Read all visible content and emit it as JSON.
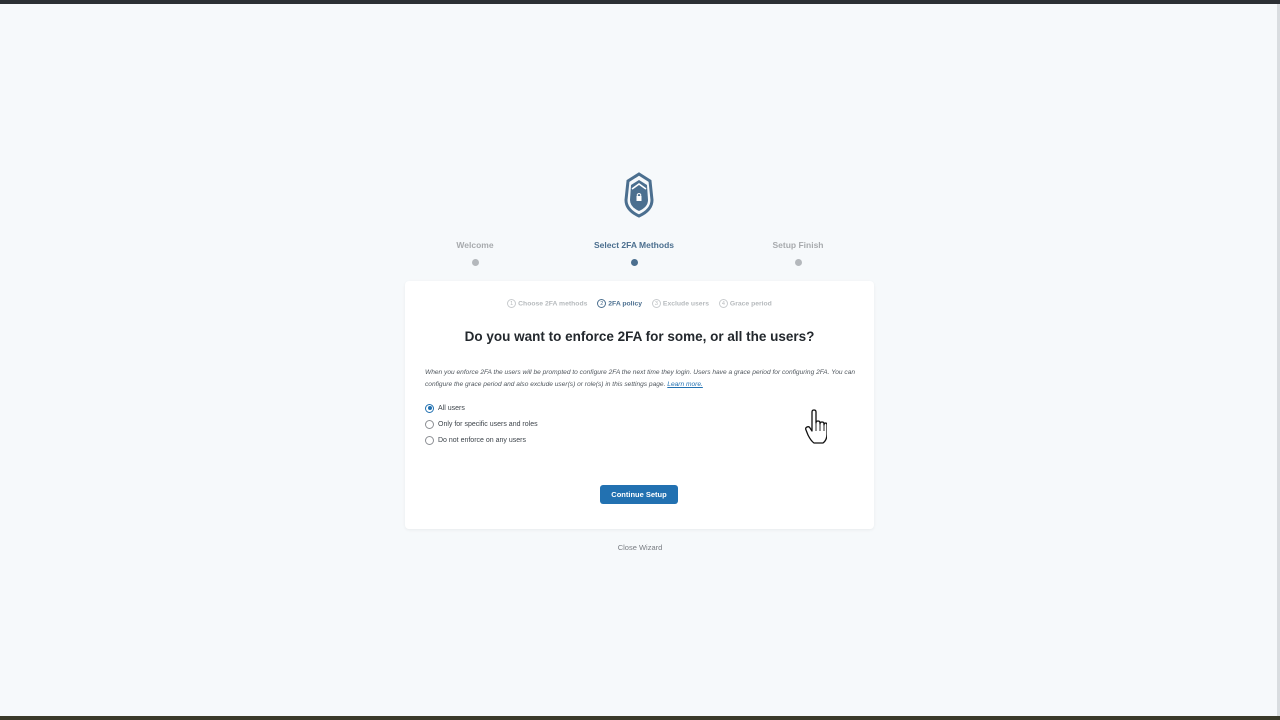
{
  "wizard": {
    "steps": [
      {
        "label": "Welcome",
        "active": false
      },
      {
        "label": "Select 2FA Methods",
        "active": true
      },
      {
        "label": "Setup Finish",
        "active": false
      }
    ],
    "substeps": [
      {
        "num": "1",
        "label": "Choose 2FA methods",
        "active": false
      },
      {
        "num": "2",
        "label": "2FA policy",
        "active": true
      },
      {
        "num": "3",
        "label": "Exclude users",
        "active": false
      },
      {
        "num": "4",
        "label": "Grace period",
        "active": false
      }
    ],
    "title": "Do you want to enforce 2FA for some, or all the users?",
    "description": "When you enforce 2FA the users will be prompted to configure 2FA the next time they login. Users have a grace period for configuring 2FA. You can configure the grace period and also exclude user(s) or role(s) in this settings page.",
    "learn_more": "Learn more.",
    "options": [
      {
        "label": "All users",
        "checked": true
      },
      {
        "label": "Only for specific users and roles",
        "checked": false
      },
      {
        "label": "Do not enforce on any users",
        "checked": false
      }
    ],
    "continue_label": "Continue Setup",
    "close_label": "Close Wizard"
  },
  "colors": {
    "accent": "#2271b1",
    "step_active": "#4b6f8f",
    "logo": "#4b6f8f"
  },
  "icons": {
    "logo": "shield-lock-icon",
    "cursor": "hand-pointer-cursor"
  }
}
